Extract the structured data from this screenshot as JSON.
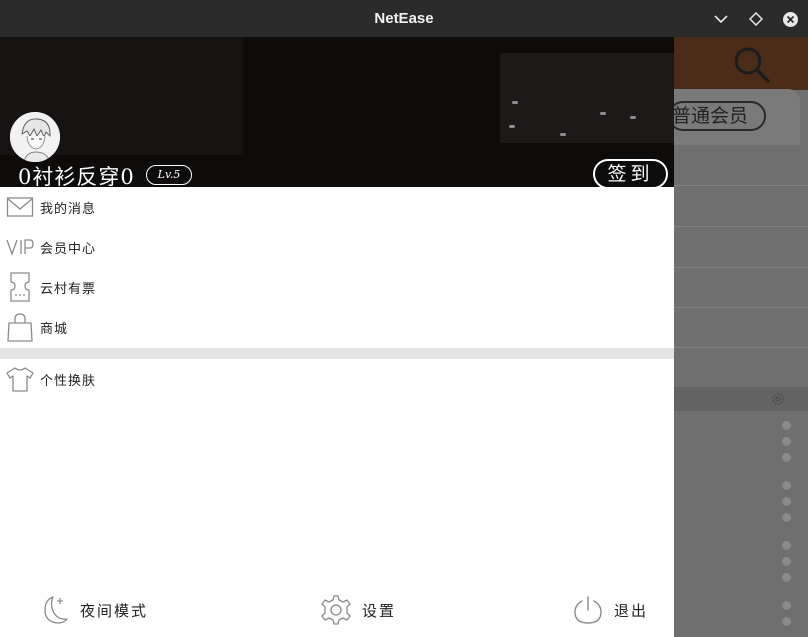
{
  "window": {
    "title": "NetEase"
  },
  "background_app": {
    "vip_badge_text": "普通会员"
  },
  "profile": {
    "username": "0衬衫反穿0",
    "level": "Lv.5",
    "checkin_label": "签到"
  },
  "menu": {
    "items": [
      {
        "label": "我的消息",
        "icon": "mail-icon"
      },
      {
        "label": "会员中心",
        "icon": "vip-icon"
      },
      {
        "label": "云村有票",
        "icon": "ticket-icon"
      },
      {
        "label": "商城",
        "icon": "shopping-bag-icon"
      }
    ],
    "items2": [
      {
        "label": "个性换肤",
        "icon": "tshirt-icon"
      }
    ]
  },
  "bottom": {
    "night_mode": "夜间模式",
    "settings": "设置",
    "logout": "退出"
  },
  "colors": {
    "titlebar": "#2b2b2b",
    "header_bg": "#0e0b0b",
    "overlay": "#6f6f6f",
    "background_topbar": "#4a2c18"
  }
}
